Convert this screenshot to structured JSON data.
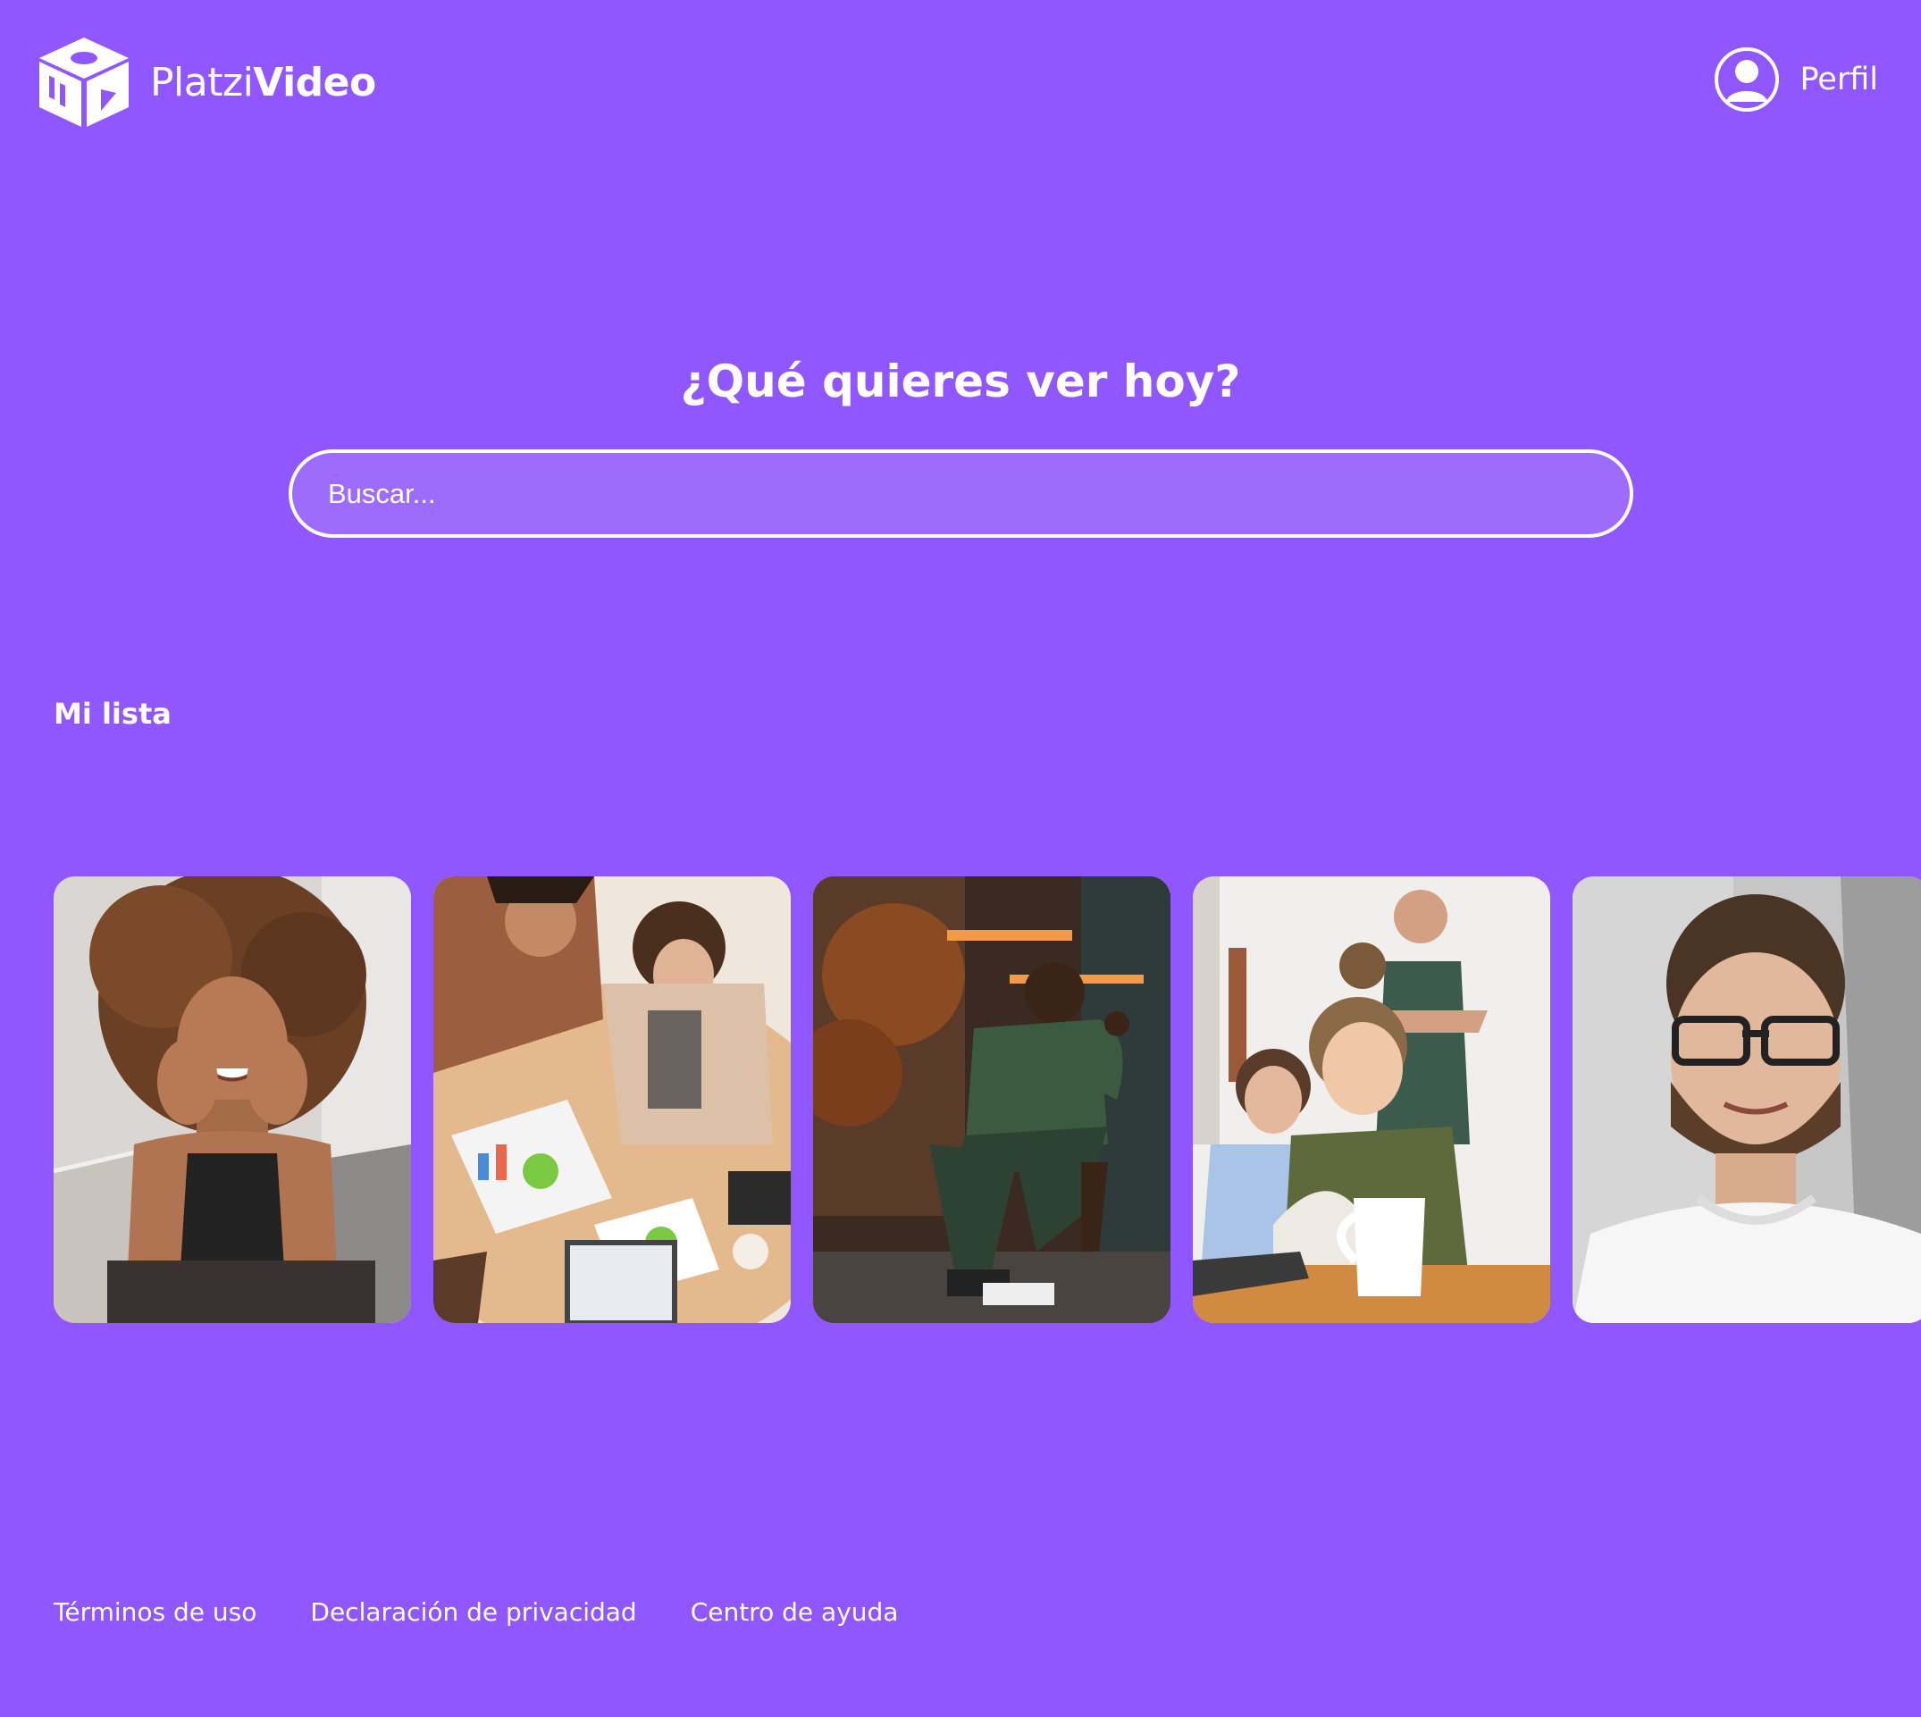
{
  "header": {
    "logo": {
      "name_light": "Platzi",
      "name_bold": "Video"
    },
    "profile": {
      "label": "Perfil"
    }
  },
  "hero": {
    "title": "¿Qué quieres ver hoy?",
    "search": {
      "placeholder": "Buscar...",
      "value": ""
    }
  },
  "my_list": {
    "title": "Mi lista",
    "items": [
      {
        "icon": "woman-curly-hair-smiling-photo"
      },
      {
        "icon": "team-meeting-charts-photo"
      },
      {
        "icon": "man-green-shirt-crouching-photo"
      },
      {
        "icon": "coworkers-coffee-laughing-photo"
      },
      {
        "icon": "man-glasses-portrait-photo"
      }
    ]
  },
  "footer": {
    "links": [
      "Términos de uso",
      "Declaración de privacidad",
      "Centro de ayuda"
    ]
  },
  "colors": {
    "background": "#8f57fd",
    "foreground": "#ffffff"
  }
}
